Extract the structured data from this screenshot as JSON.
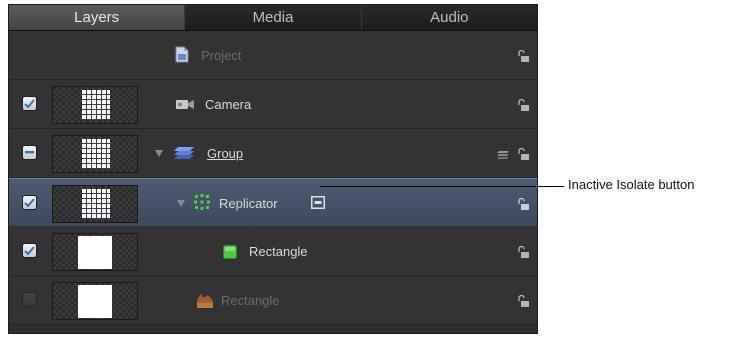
{
  "tabs": [
    {
      "label": "Layers",
      "active": true
    },
    {
      "label": "Media",
      "active": false
    },
    {
      "label": "Audio",
      "active": false
    }
  ],
  "rows": {
    "project": {
      "label": "Project"
    },
    "camera": {
      "label": "Camera",
      "checked": true
    },
    "group": {
      "label": "Group",
      "state": "mixed"
    },
    "replicator": {
      "label": "Replicator",
      "checked": true,
      "selected": true
    },
    "rectangle_1": {
      "label": "Rectangle",
      "checked": true
    },
    "rectangle_2": {
      "label": "Rectangle",
      "checked": false
    }
  },
  "callout": {
    "label": "Inactive Isolate button"
  },
  "colors": {
    "panel_bg": "#333333",
    "selection": "#46546a",
    "replicator_green": "#4fd13f",
    "group_blue": "#5b7fd6"
  }
}
